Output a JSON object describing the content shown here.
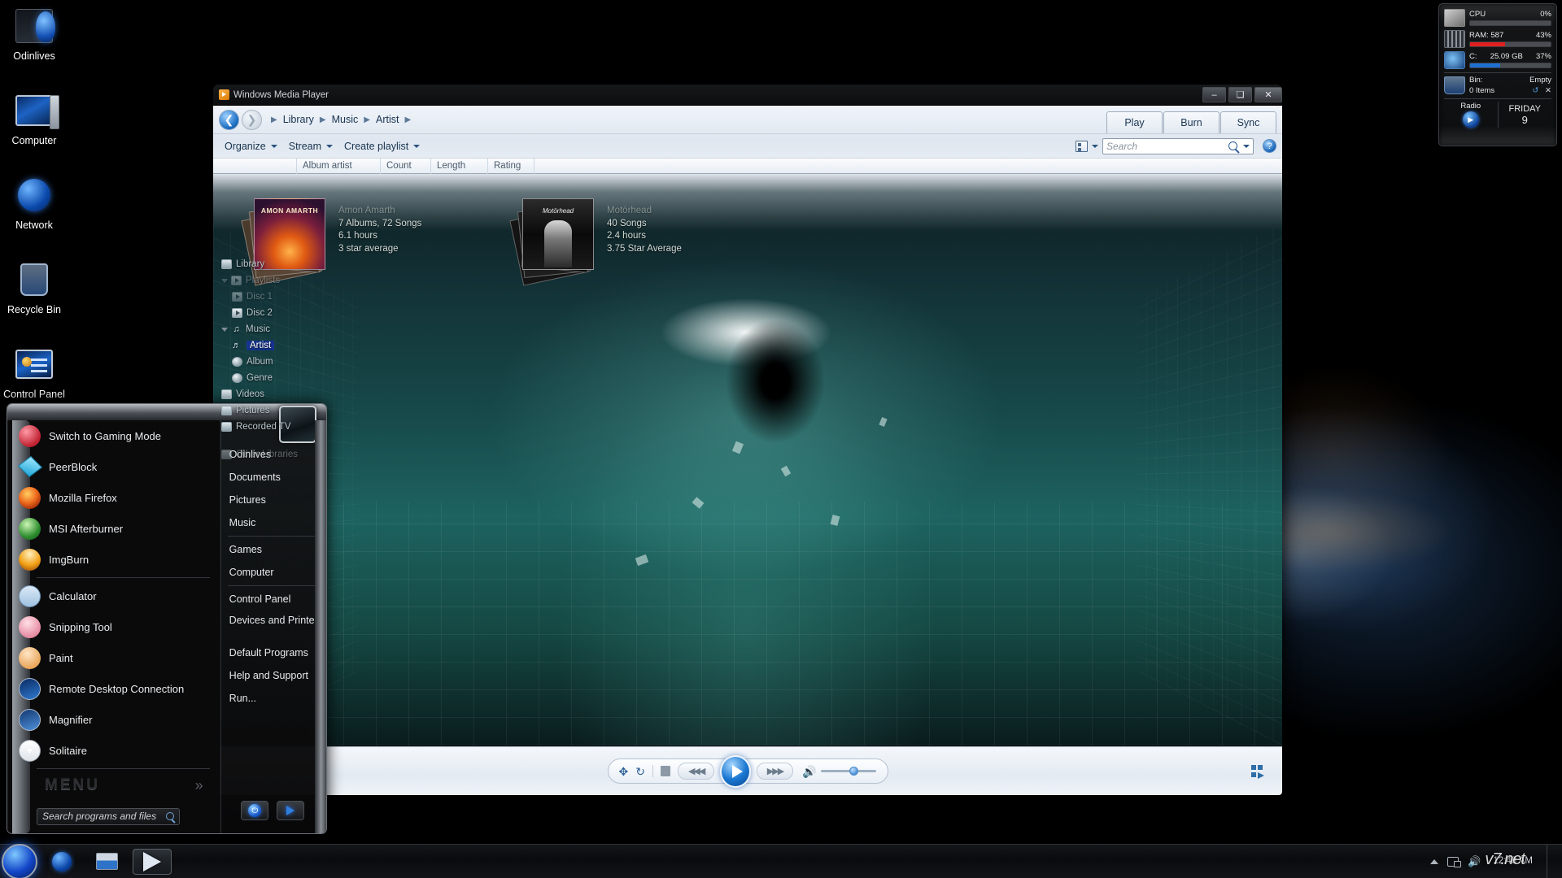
{
  "desktop": {
    "icons": [
      {
        "label": "Odinlives",
        "icon": "odinlives-icon"
      },
      {
        "label": "Computer",
        "icon": "computer-icon"
      },
      {
        "label": "Network",
        "icon": "network-icon"
      },
      {
        "label": "Recycle Bin",
        "icon": "recycle-bin-icon"
      },
      {
        "label": "Control Panel",
        "icon": "control-panel-icon"
      }
    ]
  },
  "gadget": {
    "cpu": {
      "label": "CPU",
      "value": "0%",
      "percent": 0,
      "color": "#3fa0e8"
    },
    "ram": {
      "label": "RAM: 587",
      "value": "43%",
      "percent": 43,
      "color": "#e02020"
    },
    "disk": {
      "label": "C:",
      "size": "25.09 GB",
      "value": "37%",
      "percent": 37,
      "color": "#1f6fd0"
    },
    "bin": {
      "label": "Bin:",
      "status": "Empty",
      "items": "0 Items",
      "refresh_icon": "refresh-icon",
      "delete_icon": "close-icon"
    },
    "radio": {
      "label": "Radio",
      "icon": "radio-play-icon"
    },
    "date": {
      "weekday": "FRIDAY",
      "day": "9"
    }
  },
  "wmp": {
    "title": "Windows Media Player",
    "window_buttons": {
      "minimize": "–",
      "maximize": "❑",
      "close": "✕"
    },
    "breadcrumb": [
      "Library",
      "Music",
      "Artist"
    ],
    "tabs": [
      "Play",
      "Burn",
      "Sync"
    ],
    "toolbar": {
      "organize": "Organize",
      "stream": "Stream",
      "create_playlist": "Create playlist",
      "search_placeholder": "Search",
      "help": "?"
    },
    "columns": [
      "Album artist",
      "Count",
      "Length",
      "Rating"
    ],
    "tree": [
      {
        "label": "Library",
        "level": 0,
        "icon": "library-icon",
        "expander": "none",
        "dim": false,
        "selected": false
      },
      {
        "label": "Playlists",
        "level": 0,
        "icon": "playlist-icon",
        "expander": "open",
        "dim": true,
        "selected": false
      },
      {
        "label": "Disc 1",
        "level": 1,
        "icon": "playlist-icon",
        "expander": "none",
        "dim": true,
        "selected": false
      },
      {
        "label": "Disc 2",
        "level": 1,
        "icon": "playlist-icon",
        "expander": "none",
        "dim": false,
        "selected": false
      },
      {
        "label": "Music",
        "level": 0,
        "icon": "music-note-icon",
        "expander": "open",
        "dim": false,
        "selected": false
      },
      {
        "label": "Artist",
        "level": 1,
        "icon": "artist-icon",
        "expander": "none",
        "dim": false,
        "selected": true
      },
      {
        "label": "Album",
        "level": 1,
        "icon": "album-disc-icon",
        "expander": "none",
        "dim": false,
        "selected": false
      },
      {
        "label": "Genre",
        "level": 1,
        "icon": "genre-disc-icon",
        "expander": "none",
        "dim": false,
        "selected": false
      },
      {
        "label": "Videos",
        "level": 0,
        "icon": "video-icon",
        "expander": "none",
        "dim": false,
        "selected": false
      },
      {
        "label": "Pictures",
        "level": 0,
        "icon": "pictures-icon",
        "expander": "none",
        "dim": false,
        "selected": false
      },
      {
        "label": "Recorded TV",
        "level": 0,
        "icon": "recorded-tv-icon",
        "expander": "none",
        "dim": false,
        "selected": false
      },
      {
        "label": "Other Libraries",
        "level": 0,
        "icon": "other-libraries-icon",
        "expander": "none",
        "dim": true,
        "selected": false
      }
    ],
    "albums": [
      {
        "artist": "Amon Amarth",
        "line1": "7 Albums, 72 Songs",
        "line2": "6.1 hours",
        "line3": "3 star average"
      },
      {
        "artist": "Motörhead",
        "line1": "40 Songs",
        "line2": "2.4 hours",
        "line3": "3.75 Star Average"
      }
    ],
    "transport": {
      "shuffle": "shuffle-icon",
      "repeat": "repeat-icon",
      "stop": "stop-icon",
      "previous": "previous-icon",
      "play": "play-icon",
      "next": "next-icon",
      "volume": "volume-icon",
      "volume_level": 56,
      "now_playing": "switch-to-now-playing-icon"
    }
  },
  "startmenu": {
    "programs": [
      {
        "label": "Switch to Gaming Mode",
        "icon": "gaming-mode-icon"
      },
      {
        "label": "PeerBlock",
        "icon": "peerblock-icon"
      },
      {
        "label": "Mozilla Firefox",
        "icon": "firefox-icon"
      },
      {
        "label": "MSI Afterburner",
        "icon": "msi-afterburner-icon"
      },
      {
        "label": "ImgBurn",
        "icon": "imgburn-icon"
      },
      {
        "label": "Calculator",
        "icon": "calculator-icon"
      },
      {
        "label": "Snipping Tool",
        "icon": "snipping-tool-icon"
      },
      {
        "label": "Paint",
        "icon": "paint-icon"
      },
      {
        "label": "Remote Desktop Connection",
        "icon": "remote-desktop-icon"
      },
      {
        "label": "Magnifier",
        "icon": "magnifier-icon"
      },
      {
        "label": "Solitaire",
        "icon": "solitaire-icon"
      }
    ],
    "all_programs": {
      "label": "MENU",
      "chevron": "»"
    },
    "search_placeholder": "Search programs and files",
    "right_items": [
      {
        "label": "Odinlives"
      },
      {
        "label": "Documents"
      },
      {
        "label": "Pictures"
      },
      {
        "label": "Music"
      },
      {
        "label": "Games"
      },
      {
        "label": "Computer"
      },
      {
        "label": "Control Panel"
      },
      {
        "label": "Devices and Printers"
      },
      {
        "label": "Default Programs"
      },
      {
        "label": "Help and Support"
      },
      {
        "label": "Run..."
      }
    ],
    "shutdown": {
      "power_icon": "power-icon",
      "logoff_icon": "arrow-right-icon"
    }
  },
  "taskbar": {
    "start_button": "start-orb-icon",
    "buttons": [
      {
        "name": "browser",
        "icon": "globe-icon",
        "active": false
      },
      {
        "name": "explorer",
        "icon": "folder-icon",
        "active": false
      },
      {
        "name": "media-player",
        "icon": "play-triangle-icon",
        "active": true
      }
    ],
    "tray": {
      "show_hidden": "chevron-up-icon",
      "network": "network-tray-icon",
      "volume": "volume-tray-icon",
      "clock": "12:48 AM",
      "watermark": "v7.net"
    }
  }
}
